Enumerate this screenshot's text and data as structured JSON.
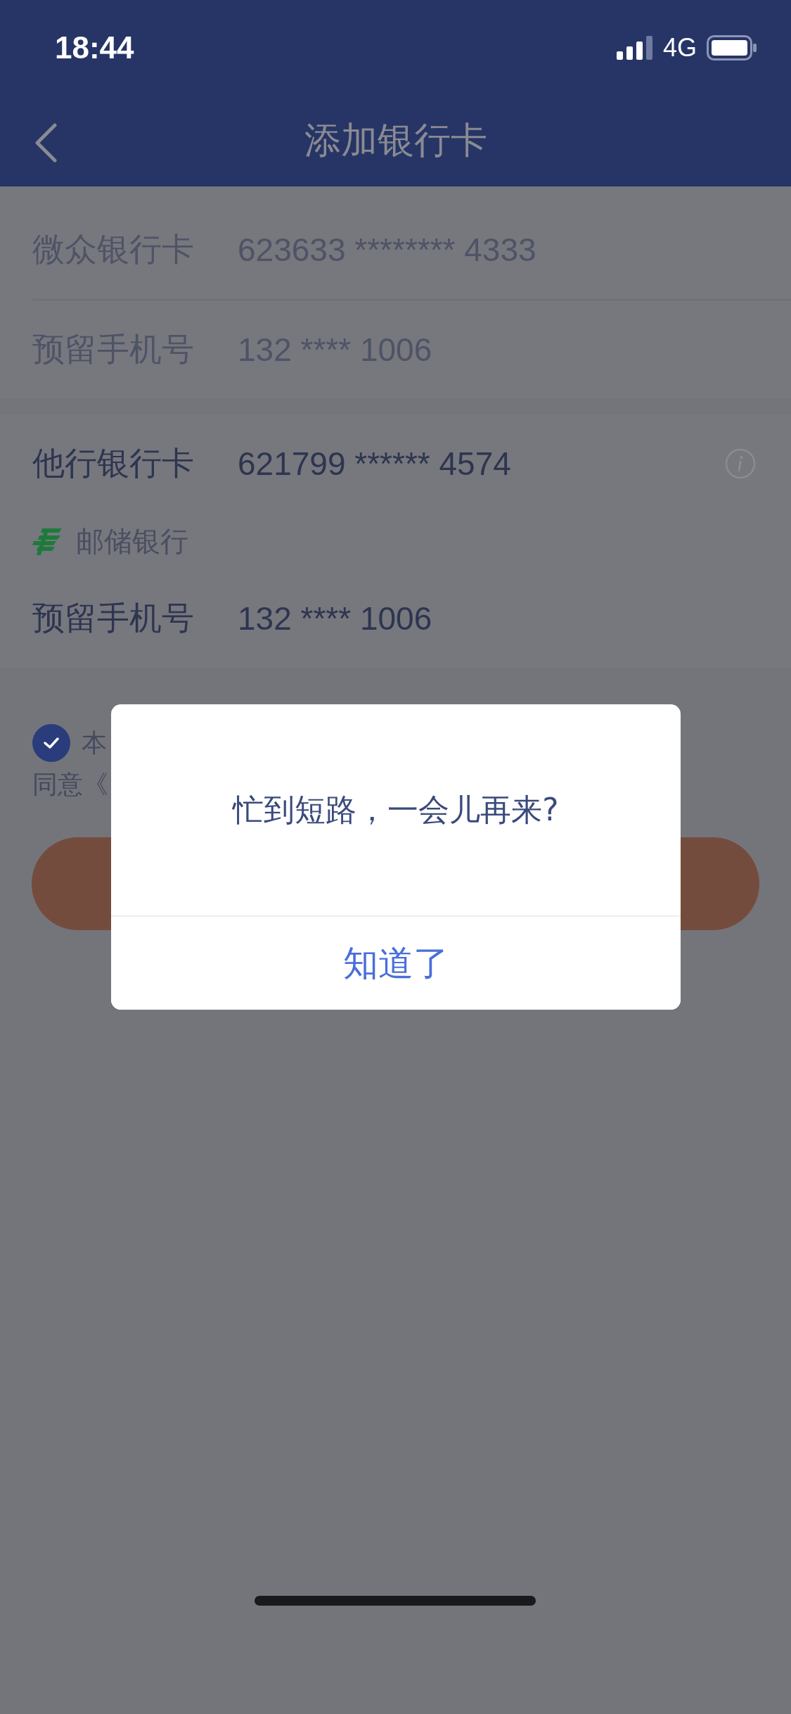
{
  "status_bar": {
    "time": "18:44",
    "network": "4G"
  },
  "nav": {
    "title": "添加银行卡"
  },
  "own_card": [
    {
      "label": "微众银行卡",
      "value": "623633 ******** 4333"
    },
    {
      "label": "预留手机号",
      "value": "132 **** 1006"
    }
  ],
  "other_card": {
    "label": "他行银行卡",
    "value": "621799 ****** 4574",
    "bank": "邮储银行",
    "phone_label": "预留手机号",
    "phone_value": "132 **** 1006"
  },
  "agreement": {
    "checked": true,
    "line_1": "本",
    "line_2": "同意《"
  },
  "dialog": {
    "message": "忙到短路，一会儿再来?",
    "button": "知道了"
  }
}
